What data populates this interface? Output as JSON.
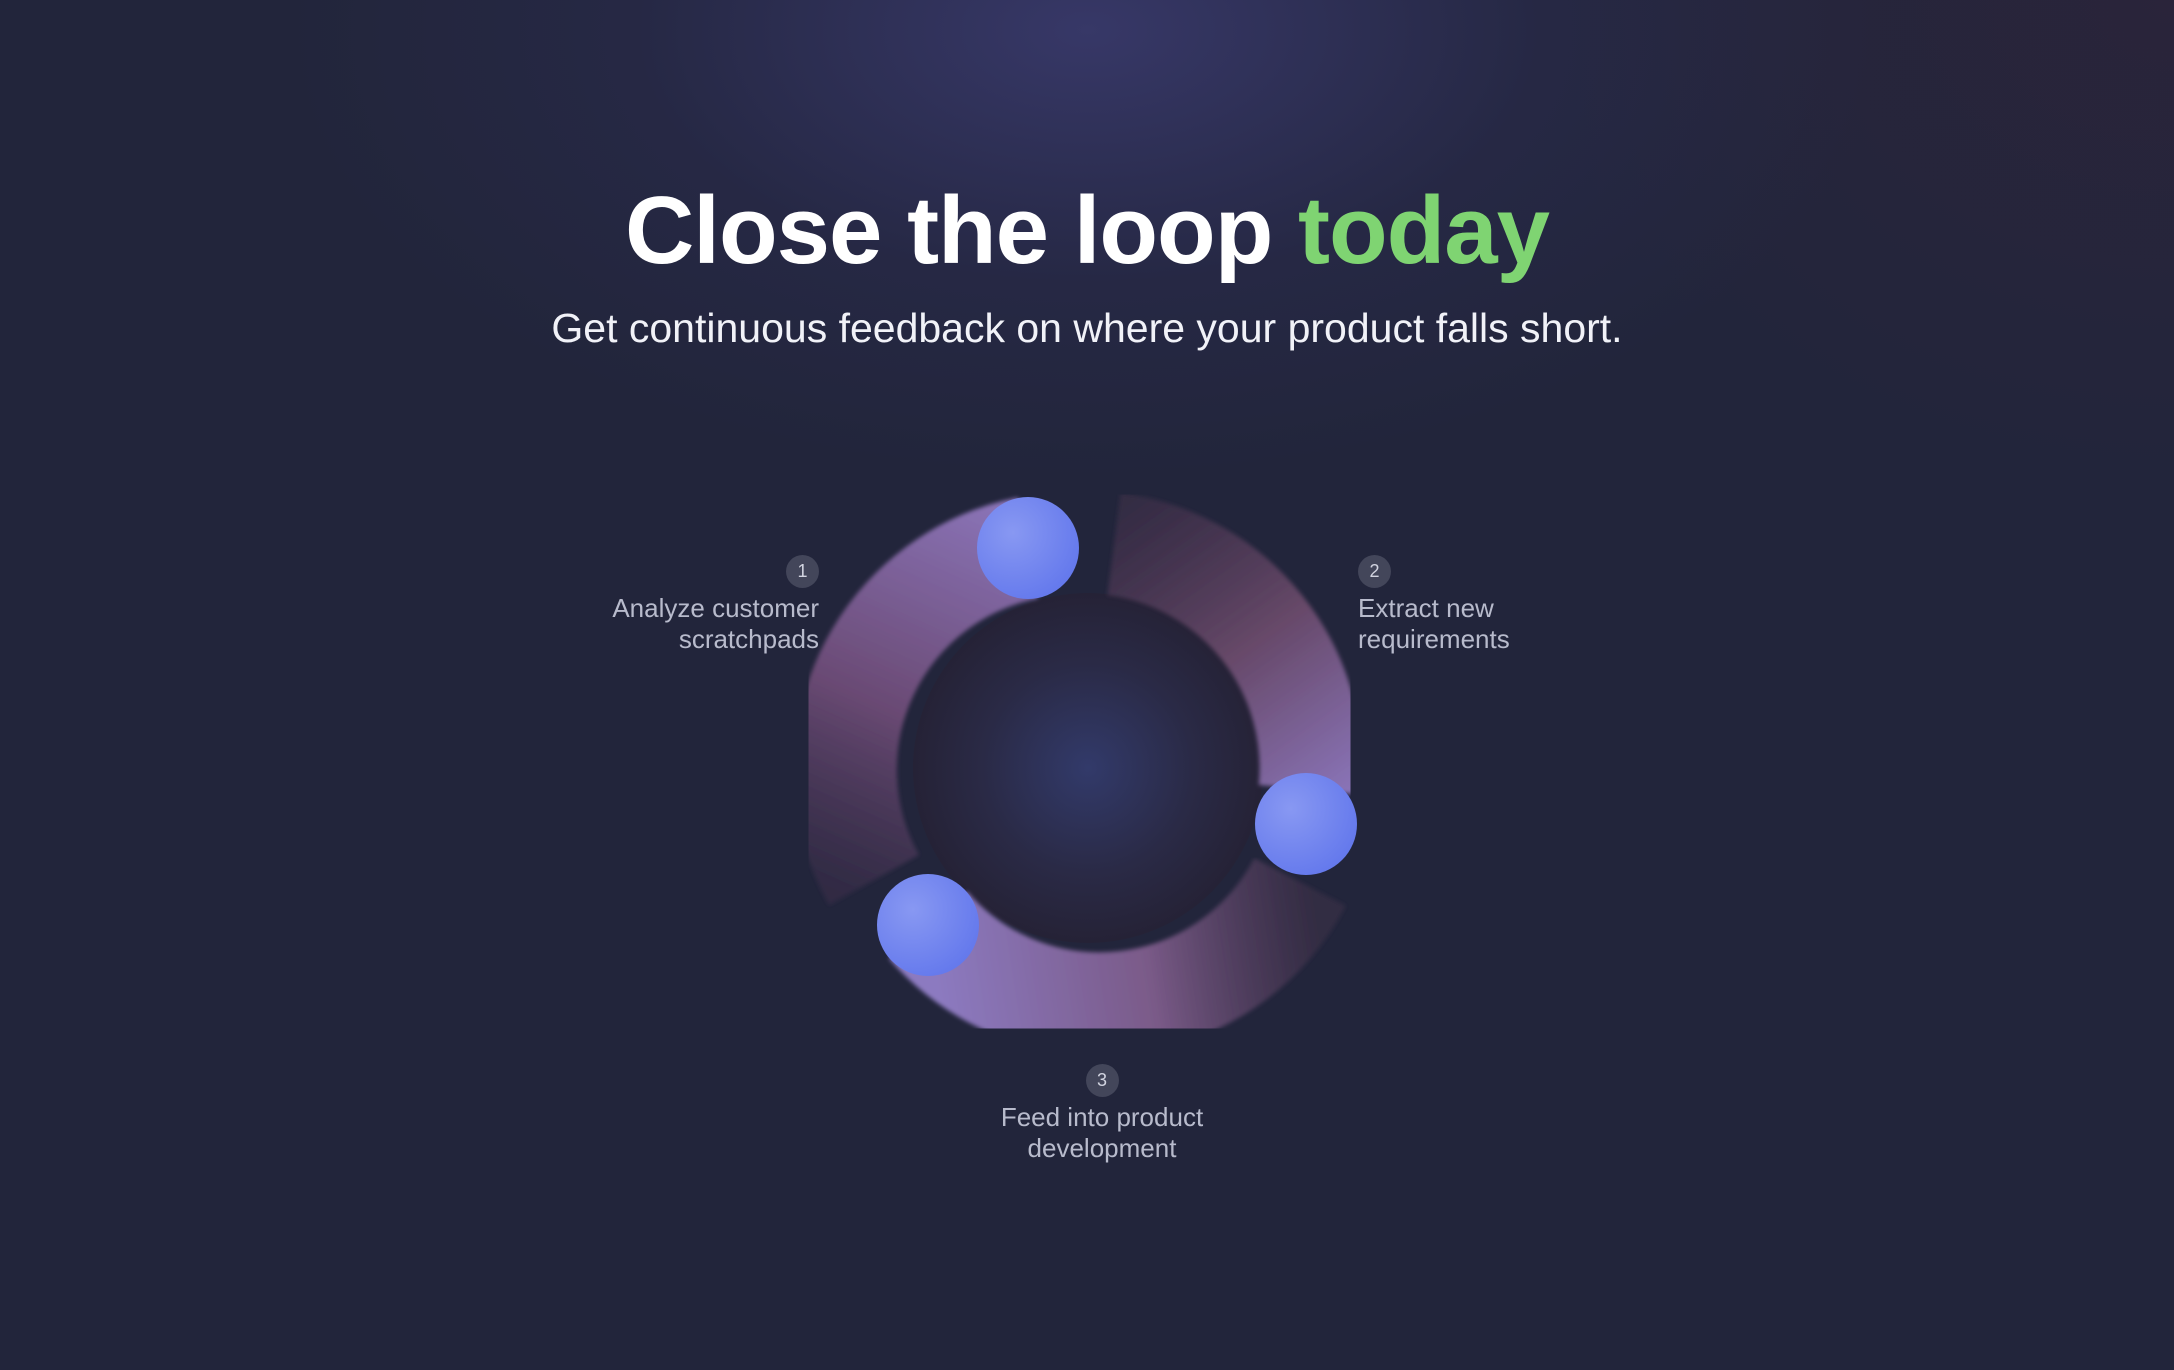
{
  "hero": {
    "title_main": "Close the loop ",
    "title_accent": "today",
    "subtitle": "Get continuous feedback on where your product falls short."
  },
  "colors": {
    "accent_green": "#7fd472",
    "node_blue": "#6d7ff0",
    "arc_mauve": "#8a6a9c",
    "background": "#22253b"
  },
  "cycle": {
    "steps": [
      {
        "number": "1",
        "label": "Analyze customer scratchpads"
      },
      {
        "number": "2",
        "label": "Extract new requirements"
      },
      {
        "number": "3",
        "label": "Feed into product development"
      }
    ]
  }
}
